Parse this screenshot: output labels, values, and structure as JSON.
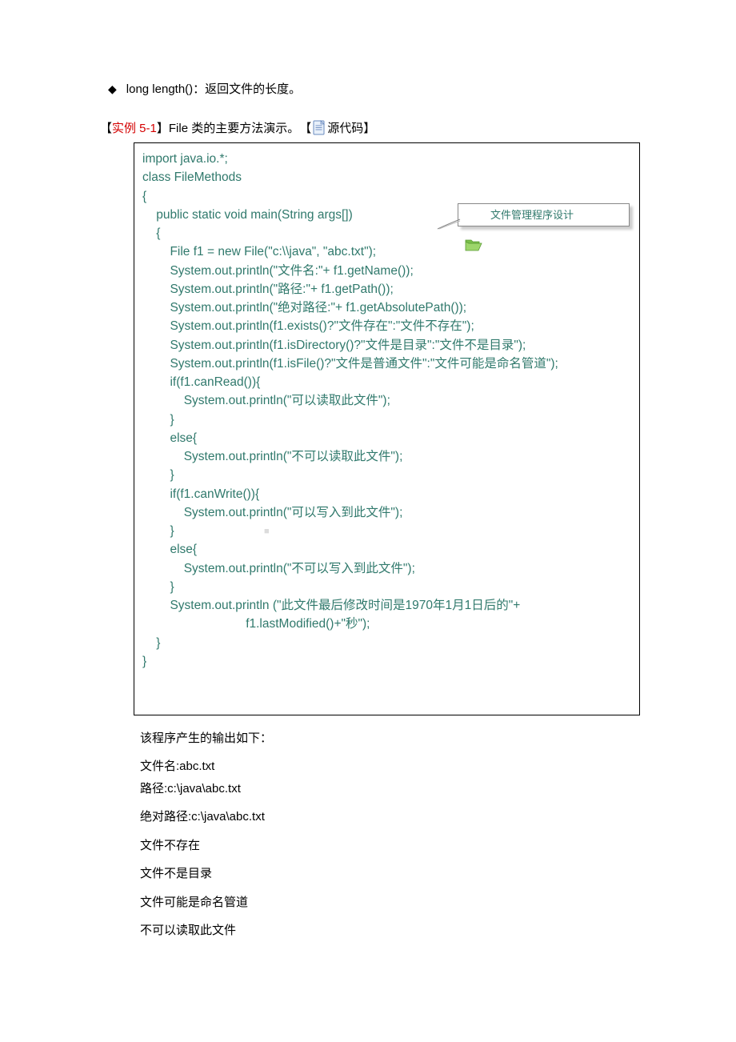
{
  "bullet": {
    "diamond": "◆",
    "method": "long length()",
    "desc": "：返回文件的长度。"
  },
  "example": {
    "open": "【",
    "label": "实例 5-1",
    "close": "】",
    "title": "File 类的主要方法演示。",
    "link_open": "【",
    "link_text": "源代码",
    "link_close": "】"
  },
  "callout": {
    "text": "文件管理程序设计"
  },
  "code": "import java.io.*;\nclass FileMethods\n{\n    public static void main(String args[])\n    {\n        File f1 = new File(\"c:\\\\java\", \"abc.txt\");\n        System.out.println(\"文件名:\"+ f1.getName());\n        System.out.println(\"路径:\"+ f1.getPath());\n        System.out.println(\"绝对路径:\"+ f1.getAbsolutePath());\n        System.out.println(f1.exists()?\"文件存在\":\"文件不存在\");\n        System.out.println(f1.isDirectory()?\"文件是目录\":\"文件不是目录\");\n        System.out.println(f1.isFile()?\"文件是普通文件\":\"文件可能是命名管道\");\n        if(f1.canRead()){\n            System.out.println(\"可以读取此文件\");\n        }\n        else{\n            System.out.println(\"不可以读取此文件\");\n        }\n        if(f1.canWrite()){\n            System.out.println(\"可以写入到此文件\");\n        }\n        else{\n            System.out.println(\"不可以写入到此文件\");\n        }\n        System.out.println (\"此文件最后修改时间是1970年1月1日后的\"+\n                              f1.lastModified()+\"秒\");\n    }\n}",
  "watermark": "■",
  "output": {
    "heading": "该程序产生的输出如下：",
    "lines": [
      "文件名:abc.txt",
      "路径:c:\\java\\abc.txt",
      "绝对路径:c:\\java\\abc.txt",
      "文件不存在",
      "文件不是目录",
      "文件可能是命名管道",
      "不可以读取此文件"
    ]
  }
}
